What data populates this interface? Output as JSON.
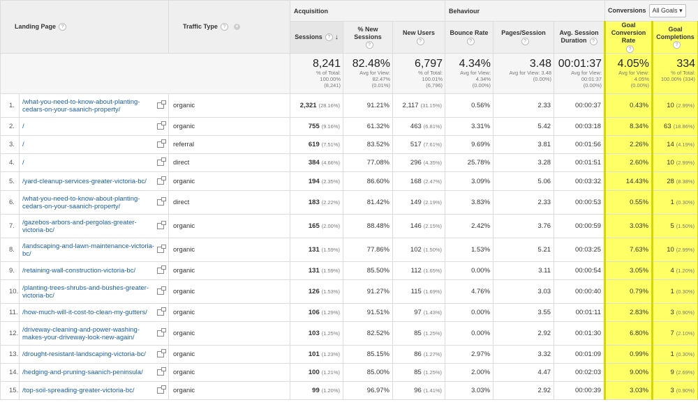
{
  "header": {
    "landing_page": "Landing Page",
    "traffic_type": "Traffic Type",
    "acquisition": "Acquisition",
    "behaviour": "Behaviour",
    "conversions": "Conversions",
    "goal_select": "All Goals",
    "columns": {
      "sessions": "Sessions",
      "pct_new_sessions": "% New Sessions",
      "new_users": "New Users",
      "bounce_rate": "Bounce Rate",
      "pages_session": "Pages/Session",
      "avg_session_duration": "Avg. Session Duration",
      "goal_conv_rate": "Goal Conversion Rate",
      "goal_completions": "Goal Completions"
    }
  },
  "totals": {
    "sessions": {
      "big": "8,241",
      "l1": "% of Total:",
      "l2": "100.00%",
      "l3": "(8,241)"
    },
    "pct_new": {
      "big": "82.48%",
      "l1": "Avg for View:",
      "l2": "82.47%",
      "l3": "(0.01%)"
    },
    "new_users": {
      "big": "6,797",
      "l1": "% of Total:",
      "l2": "100.01%",
      "l3": "(6,796)"
    },
    "bounce": {
      "big": "4.34%",
      "l1": "Avg for View:",
      "l2": "4.34%",
      "l3": "(0.00%)"
    },
    "pages": {
      "big": "3.48",
      "l1": "Avg for View: 3.48",
      "l2": "(0.00%)",
      "l3": ""
    },
    "duration": {
      "big": "00:01:37",
      "l1": "Avg for View:",
      "l2": "00:01:37",
      "l3": "(0.00%)"
    },
    "conv_rate": {
      "big": "4.05%",
      "l1": "Avg for View:",
      "l2": "4.05%",
      "l3": "(0.00%)"
    },
    "completions": {
      "big": "334",
      "l1": "% of Total:",
      "l2": "100.00% (334)",
      "l3": ""
    }
  },
  "rows": [
    {
      "n": "1.",
      "page": "/what-you-need-to-know-about-planting-cedars-on-your-saanich-property/",
      "type": "organic",
      "sessions": "2,321",
      "sp": "(28.16%)",
      "pnew": "91.21%",
      "users": "2,117",
      "up": "(31.15%)",
      "bounce": "0.56%",
      "pages": "2.33",
      "dur": "00:00:37",
      "conv": "0.43%",
      "comp": "10",
      "cp": "(2.99%)"
    },
    {
      "n": "2.",
      "page": "/",
      "type": "organic",
      "sessions": "755",
      "sp": "(9.16%)",
      "pnew": "61.32%",
      "users": "463",
      "up": "(6.81%)",
      "bounce": "3.31%",
      "pages": "5.42",
      "dur": "00:03:18",
      "conv": "8.34%",
      "comp": "63",
      "cp": "(18.86%)"
    },
    {
      "n": "3.",
      "page": "/",
      "type": "referral",
      "sessions": "619",
      "sp": "(7.51%)",
      "pnew": "83.52%",
      "users": "517",
      "up": "(7.61%)",
      "bounce": "9.69%",
      "pages": "3.81",
      "dur": "00:01:56",
      "conv": "2.26%",
      "comp": "14",
      "cp": "(4.19%)"
    },
    {
      "n": "4.",
      "page": "/",
      "type": "direct",
      "sessions": "384",
      "sp": "(4.66%)",
      "pnew": "77.08%",
      "users": "296",
      "up": "(4.35%)",
      "bounce": "25.78%",
      "pages": "3.28",
      "dur": "00:01:51",
      "conv": "2.60%",
      "comp": "10",
      "cp": "(2.99%)"
    },
    {
      "n": "5.",
      "page": "/yard-cleanup-services-greater-victoria-bc/",
      "type": "organic",
      "sessions": "194",
      "sp": "(2.35%)",
      "pnew": "86.60%",
      "users": "168",
      "up": "(2.47%)",
      "bounce": "3.09%",
      "pages": "5.06",
      "dur": "00:03:32",
      "conv": "14.43%",
      "comp": "28",
      "cp": "(8.38%)"
    },
    {
      "n": "6.",
      "page": "/what-you-need-to-know-about-planting-cedars-on-your-saanich-property/",
      "type": "direct",
      "sessions": "183",
      "sp": "(2.22%)",
      "pnew": "81.42%",
      "users": "149",
      "up": "(2.19%)",
      "bounce": "3.83%",
      "pages": "2.33",
      "dur": "00:00:53",
      "conv": "0.55%",
      "comp": "1",
      "cp": "(0.30%)"
    },
    {
      "n": "7.",
      "page": "/gazebos-arbors-and-pergolas-greater-victoria-bc/",
      "type": "organic",
      "sessions": "165",
      "sp": "(2.00%)",
      "pnew": "88.48%",
      "users": "146",
      "up": "(2.15%)",
      "bounce": "2.42%",
      "pages": "3.76",
      "dur": "00:00:59",
      "conv": "3.03%",
      "comp": "5",
      "cp": "(1.50%)"
    },
    {
      "n": "8.",
      "page": "/landscaping-and-lawn-maintenance-victoria-bc/",
      "type": "organic",
      "sessions": "131",
      "sp": "(1.59%)",
      "pnew": "77.86%",
      "users": "102",
      "up": "(1.50%)",
      "bounce": "1.53%",
      "pages": "5.21",
      "dur": "00:03:25",
      "conv": "7.63%",
      "comp": "10",
      "cp": "(2.99%)"
    },
    {
      "n": "9.",
      "page": "/retaining-wall-construction-victoria-bc/",
      "type": "organic",
      "sessions": "131",
      "sp": "(1.59%)",
      "pnew": "85.50%",
      "users": "112",
      "up": "(1.65%)",
      "bounce": "0.00%",
      "pages": "3.11",
      "dur": "00:00:54",
      "conv": "3.05%",
      "comp": "4",
      "cp": "(1.20%)"
    },
    {
      "n": "10.",
      "page": "/planting-trees-shrubs-and-bushes-greater-victoria-bc/",
      "type": "organic",
      "sessions": "126",
      "sp": "(1.53%)",
      "pnew": "91.27%",
      "users": "115",
      "up": "(1.69%)",
      "bounce": "4.76%",
      "pages": "3.03",
      "dur": "00:00:40",
      "conv": "0.79%",
      "comp": "1",
      "cp": "(0.30%)"
    },
    {
      "n": "11.",
      "page": "/how-much-will-it-cost-to-clean-my-gutters/",
      "type": "organic",
      "sessions": "106",
      "sp": "(1.29%)",
      "pnew": "91.51%",
      "users": "97",
      "up": "(1.43%)",
      "bounce": "0.00%",
      "pages": "3.55",
      "dur": "00:01:11",
      "conv": "2.83%",
      "comp": "3",
      "cp": "(0.90%)"
    },
    {
      "n": "12.",
      "page": "/driveway-cleaning-and-power-washing-makes-your-driveway-look-new-again/",
      "type": "organic",
      "sessions": "103",
      "sp": "(1.25%)",
      "pnew": "82.52%",
      "users": "85",
      "up": "(1.25%)",
      "bounce": "0.00%",
      "pages": "2.92",
      "dur": "00:01:30",
      "conv": "6.80%",
      "comp": "7",
      "cp": "(2.10%)"
    },
    {
      "n": "13.",
      "page": "/drought-resistant-landscaping-victoria-bc/",
      "type": "organic",
      "sessions": "101",
      "sp": "(1.23%)",
      "pnew": "85.15%",
      "users": "86",
      "up": "(1.27%)",
      "bounce": "2.97%",
      "pages": "3.32",
      "dur": "00:01:09",
      "conv": "0.99%",
      "comp": "1",
      "cp": "(0.30%)"
    },
    {
      "n": "14.",
      "page": "/hedging-and-pruning-saanich-peninsula/",
      "type": "organic",
      "sessions": "100",
      "sp": "(1.21%)",
      "pnew": "85.00%",
      "users": "85",
      "up": "(1.25%)",
      "bounce": "2.00%",
      "pages": "4.47",
      "dur": "00:02:03",
      "conv": "9.00%",
      "comp": "9",
      "cp": "(2.69%)"
    },
    {
      "n": "15.",
      "page": "/top-soil-spreading-greater-victoria-bc/",
      "type": "organic",
      "sessions": "99",
      "sp": "(1.20%)",
      "pnew": "96.97%",
      "users": "96",
      "up": "(1.41%)",
      "bounce": "3.03%",
      "pages": "2.92",
      "dur": "00:00:39",
      "conv": "3.03%",
      "comp": "3",
      "cp": "(0.90%)"
    }
  ]
}
